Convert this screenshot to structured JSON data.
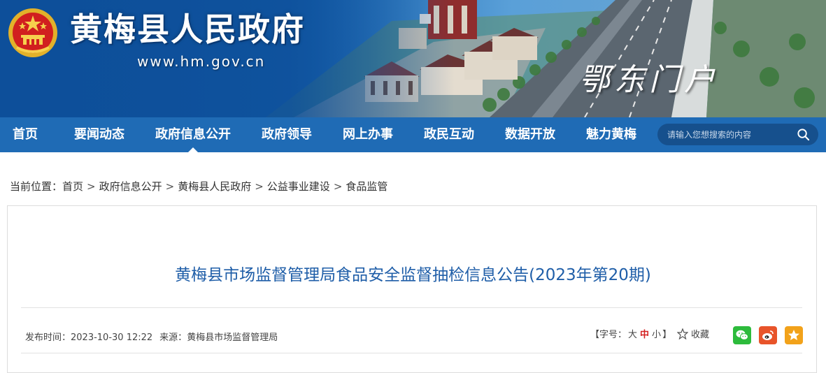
{
  "header": {
    "site_title": "黄梅县人民政府",
    "site_url": "www.hm.gov.cn",
    "slogan": "鄂东门户"
  },
  "nav": {
    "items": [
      {
        "label": "首页"
      },
      {
        "label": "要闻动态"
      },
      {
        "label": "政府信息公开",
        "active": true
      },
      {
        "label": "政府领导"
      },
      {
        "label": "网上办事"
      },
      {
        "label": "政民互动"
      },
      {
        "label": "数据开放"
      },
      {
        "label": "魅力黄梅"
      }
    ],
    "search": {
      "placeholder": "请输入您想搜索的内容",
      "icon": "search-icon"
    }
  },
  "breadcrumb": {
    "prefix": "当前位置：",
    "items": [
      "首页",
      "政府信息公开",
      "黄梅县人民政府",
      "公益事业建设",
      "食品监管"
    ],
    "separator": ">"
  },
  "article": {
    "title": "黄梅县市场监督管理局食品安全监督抽检信息公告(2023年第20期)",
    "publish_label": "发布时间：",
    "publish_time": "2023-10-30 12:22",
    "source_label": "来源：",
    "source": "黄梅县市场监督管理局",
    "font_size": {
      "open": "【字号：",
      "large": "大",
      "medium": "中",
      "small": "小",
      "close": "】",
      "selected": "中"
    },
    "favorite_label": "收藏",
    "share": [
      {
        "name": "wechat",
        "color": "#2dbb3c"
      },
      {
        "name": "weibo",
        "color": "#e8542a"
      },
      {
        "name": "qzone",
        "color": "#f2a21a"
      }
    ]
  },
  "colors": {
    "nav_bg": "#1f6bb5",
    "title_blue": "#1f5ea8",
    "highlight_red": "#d42020"
  }
}
